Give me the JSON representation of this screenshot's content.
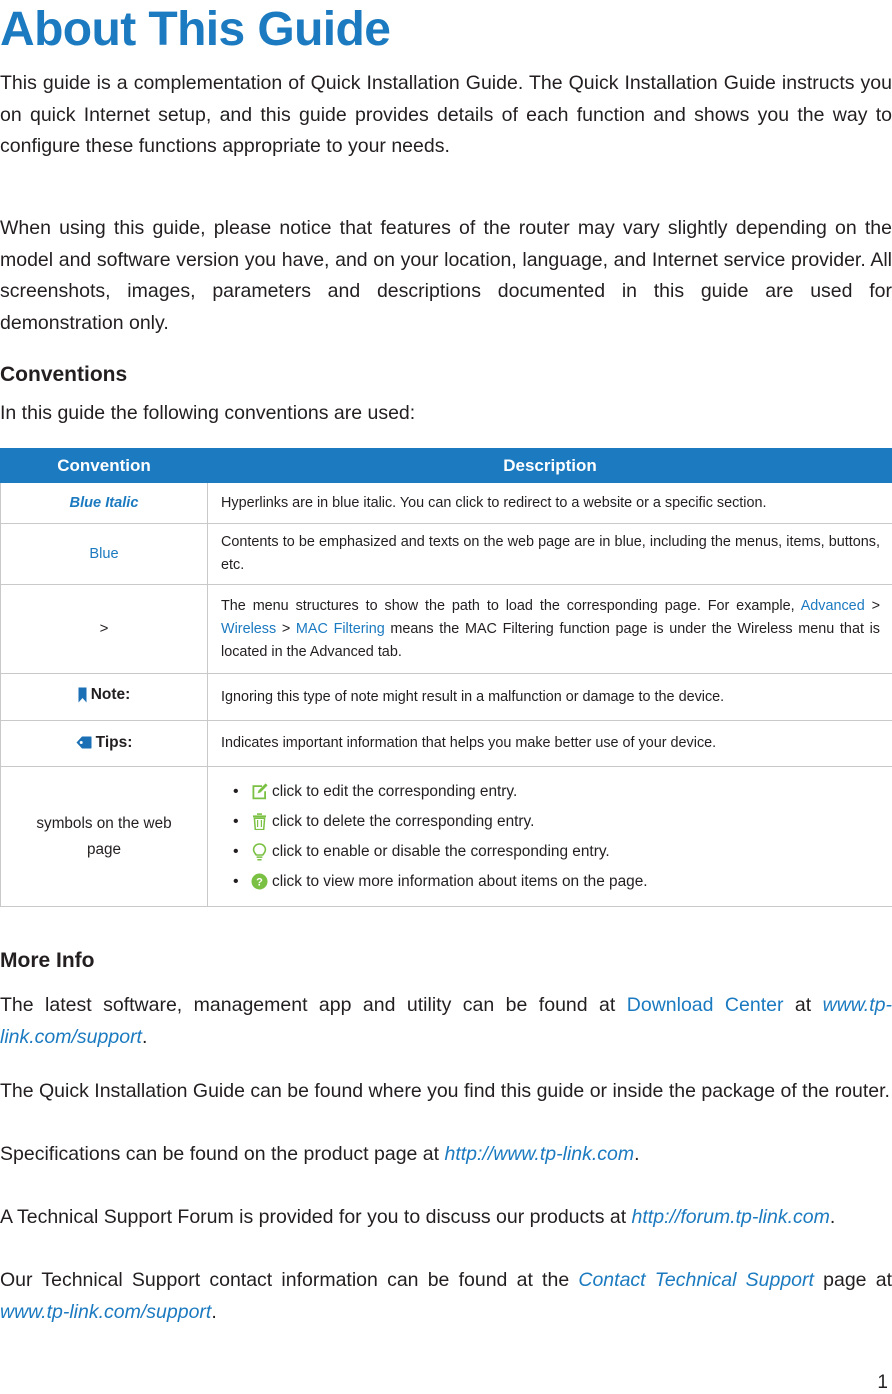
{
  "document": {
    "title": "About This Guide",
    "page_number": "1",
    "accent_blue": "#1b7ac0",
    "icon_green": "#7ac143",
    "text_color": "#231f20",
    "border_color": "#c9c9c9"
  },
  "intro": {
    "paragraph_1": "This guide is a complementation of Quick Installation Guide. The Quick Installation Guide instructs you on quick Internet setup, and this guide provides details of each function and shows you the way to configure these functions appropriate to your needs.",
    "paragraph_2": "When using this guide, please notice that  features of the router may vary slightly depending on the model and software version you have, and on your location, language, and Internet service provider. All screenshots, images, parameters and descriptions documented in this guide are used for demonstration only."
  },
  "conventions": {
    "heading": "Conventions",
    "lead_in": "In this guide the following conventions are used:",
    "table": {
      "headers": {
        "convention": "Convention",
        "description": "Description"
      },
      "rows": [
        {
          "convention": "Blue Italic",
          "convention_style": "blue-italic",
          "description": "Hyperlinks are in blue italic. You can click to redirect to a website or a specific section."
        },
        {
          "convention": "Blue",
          "convention_style": "blue",
          "description": "Contents to be emphasized and texts on the web page are in blue, including the menus, items, buttons, etc."
        },
        {
          "convention": ">",
          "convention_style": "plain",
          "description_parts": {
            "before": "The menu structures to show the path to load the corresponding page. For example, ",
            "link_1": "Advanced",
            "sep_1": " > ",
            "link_2": "Wireless",
            "sep_2": " > ",
            "link_3": "MAC Filtering",
            "after": " means the MAC Filtering function page is under the Wireless menu that is located in the Advanced tab."
          }
        },
        {
          "convention": "Note:",
          "convention_style": "note",
          "icon": "bookmark-icon",
          "description": "Ignoring this type of note might result in a malfunction or damage to the device."
        },
        {
          "convention": "Tips:",
          "convention_style": "tips",
          "icon": "tag-icon",
          "description": "Indicates important information that helps you make better use of your device."
        },
        {
          "convention": "symbols on the web page",
          "convention_style": "plain-wrap",
          "symbols": [
            {
              "bullet": "•",
              "icon": "edit-icon",
              "text": "click to edit the corresponding entry."
            },
            {
              "bullet": "•",
              "icon": "trash-icon",
              "text": "click to delete the corresponding entry."
            },
            {
              "bullet": "•",
              "icon": "bulb-icon",
              "text": "click to enable or disable the corresponding entry."
            },
            {
              "bullet": "•",
              "icon": "help-icon",
              "text": "click to view more information about items on the page."
            }
          ]
        }
      ]
    }
  },
  "more_info": {
    "heading": "More Info",
    "paragraph_1": {
      "before": "The latest software, management app and utility can be found at ",
      "link_1": "Download Center",
      "middle": " at ",
      "link_2": "www.tp-link.com/support",
      "after": "."
    },
    "paragraph_2": "The Quick Installation Guide can be found where you find this guide or inside the package of the router.",
    "paragraph_3": {
      "before": "Specifications can be found on the product page at ",
      "link_1": "http://www.tp-link.com",
      "after": "."
    },
    "paragraph_4": {
      "before": "A Technical Support Forum is provided for you to discuss our products at ",
      "link_1": "http://forum.tp-link.com",
      "after": "."
    },
    "paragraph_5": {
      "before": "Our Technical Support contact information can be found at the ",
      "link_1": "Contact Technical Support",
      "middle": " page at ",
      "link_2": "www.tp-link.com/support",
      "after": "."
    }
  }
}
